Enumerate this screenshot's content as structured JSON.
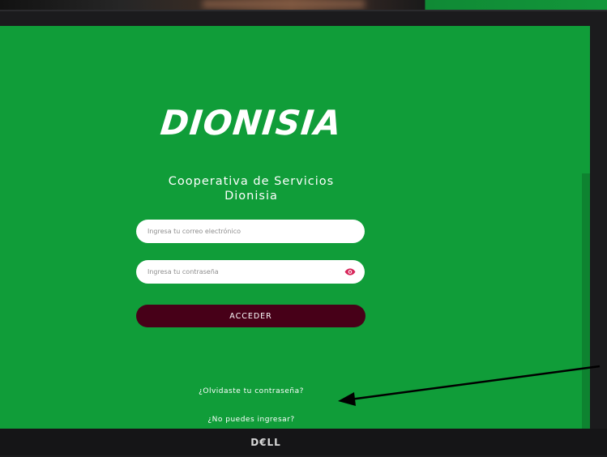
{
  "brand": {
    "logo_text": "DIONISIA",
    "subtitle_line1": "Cooperativa de Servicios",
    "subtitle_line2": "Dionisia"
  },
  "form": {
    "email_placeholder": "Ingresa tu correo electrónico",
    "password_placeholder": "Ingresa tu contraseña",
    "submit_label": "ACCEDER"
  },
  "links": {
    "forgot_password": "¿Olvidaste tu contraseña?",
    "cannot_login": "¿No puedes ingresar?"
  },
  "monitor": {
    "brand_logo": "D€LL"
  },
  "icons": {
    "password_toggle": "eye-icon"
  },
  "colors": {
    "background": "#109d39",
    "button": "#470018",
    "eye_icon": "#d7265a",
    "text": "#ffffff"
  }
}
